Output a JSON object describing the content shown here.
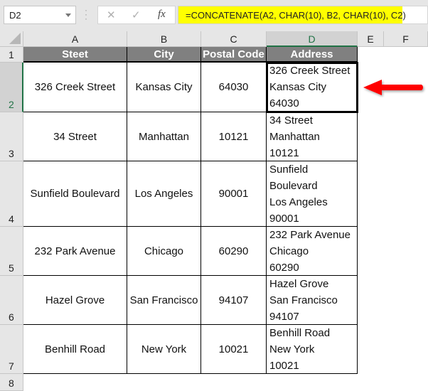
{
  "formula_bar": {
    "name_box": "D2",
    "cancel_icon": "✕",
    "enter_icon": "✓",
    "fx_label": "fx",
    "formula": "=CONCATENATE(A2, CHAR(10), B2, CHAR(10), C2)",
    "highlight_color": "#ffff00"
  },
  "columns": [
    "A",
    "B",
    "C",
    "D",
    "E",
    "F"
  ],
  "rows": [
    "1",
    "2",
    "3",
    "4",
    "5",
    "6",
    "7",
    "8"
  ],
  "selected_cell": "D2",
  "table": {
    "headers": [
      "Steet",
      "City",
      "Postal Code",
      "Address"
    ],
    "header_bg": "#808080",
    "rows": [
      {
        "street": "326 Creek Street",
        "city": "Kansas City",
        "postal": "64030",
        "address": [
          "326 Creek Street",
          "Kansas City",
          "64030"
        ]
      },
      {
        "street": "34 Street",
        "city": "Manhattan",
        "postal": "10121",
        "address": [
          "34 Street",
          "Manhattan",
          "10121"
        ]
      },
      {
        "street": "Sunfield Boulevard",
        "city": "Los Angeles",
        "postal": "90001",
        "address": [
          "Sunfield",
          "Boulevard",
          "Los Angeles",
          "90001"
        ]
      },
      {
        "street": "232 Park Avenue",
        "city": "Chicago",
        "postal": "60290",
        "address": [
          "232 Park Avenue",
          "Chicago",
          "60290"
        ]
      },
      {
        "street": "Hazel Grove",
        "city": "San Francisco",
        "postal": "94107",
        "address": [
          "Hazel Grove",
          "San Francisco",
          "94107"
        ]
      },
      {
        "street": "Benhill Road",
        "city": "New York",
        "postal": "10021",
        "address": [
          "Benhill Road",
          "New York",
          "10021"
        ]
      }
    ]
  },
  "annotation": {
    "arrow_color": "#ff0000",
    "points_to": "D2"
  }
}
